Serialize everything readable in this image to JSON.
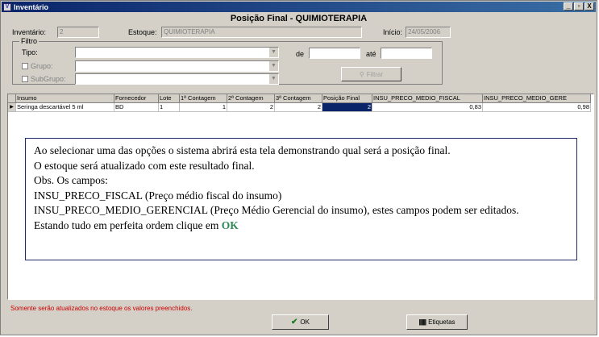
{
  "window": {
    "title": "Inventário",
    "icon": "app-icon",
    "controls": [
      "_",
      "▫",
      "X"
    ]
  },
  "heading": "Posição Final - QUIMIOTERAPIA",
  "header": {
    "inventario_label": "Inventário:",
    "inventario_value": "2",
    "estoque_label": "Estoque:",
    "estoque_value": "QUIMIOTERAPIA",
    "inicio_label": "Início:",
    "inicio_value": "24/05/2006"
  },
  "filter": {
    "title": "Filtro",
    "tipo_label": "Tipo:",
    "grupo_label": "Grupo:",
    "subgrupo_label": "SubGrupo:",
    "de_label": "de",
    "ate_label": "até",
    "filter_button": "Filtrar"
  },
  "grid": {
    "columns": [
      "Insumo",
      "Fornecedor",
      "Lote",
      "1ª Contagem",
      "2ª Contagem",
      "3ª Contagem",
      "Posição Final",
      "INSU_PRECO_MEDIO_FISCAL",
      "INSU_PRECO_MEDIO_GERE"
    ],
    "rows": [
      [
        "Seringa descartável 5 ml",
        "BD",
        "1",
        "1",
        "2",
        "2",
        "2",
        "0,83",
        "0,98"
      ]
    ]
  },
  "note": {
    "line1": "Ao selecionar uma das opções o sistema abrirá esta tela demonstrando qual será a posição final.",
    "line2": "O estoque será atualizado com este resultado final.",
    "line3": "Obs. Os campos:",
    "line4": "INSU_PRECO_FISCAL (Preço médio fiscal do insumo)",
    "line5": "INSU_PRECO_MEDIO_GERENCIAL (Preço Médio Gerencial do insumo), estes campos podem ser editados.",
    "line6_prefix": "Estando tudo em perfeita ordem clique em",
    "line6_ok": "OK"
  },
  "status_text": "Somente serão atualizados no estoque os valores preenchidos.",
  "buttons": {
    "ok": "OK",
    "etiquetas": "Etiquetas"
  },
  "colors": {
    "titlebar": "#0a246a",
    "selection": "#0a246a",
    "status": "#cc0000",
    "ok_highlight": "#2e8b57"
  }
}
